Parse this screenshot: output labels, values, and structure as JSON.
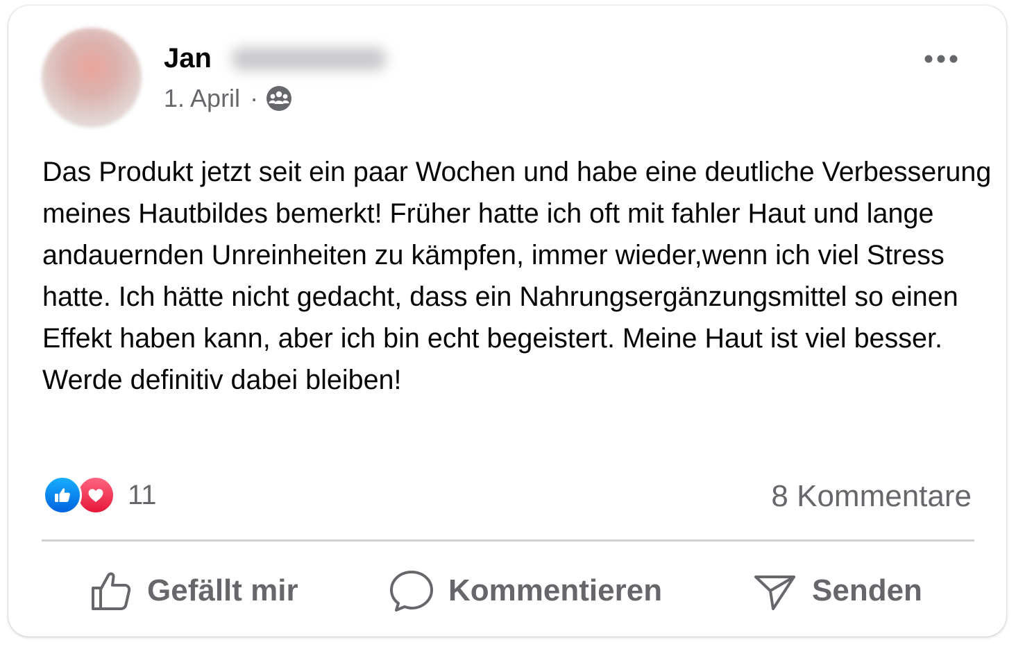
{
  "post": {
    "author_first_name": "Jan",
    "date": "1. April",
    "separator": "·",
    "audience_icon": "group-icon",
    "more_icon": "more-options-icon",
    "text": "Das Produkt jetzt seit ein paar Wochen und habe eine deutliche Verbesserung meines Hautbildes bemerkt! Früher hatte ich oft mit fahler Haut und lange andauernden Unreinheiten zu kämpfen, immer wieder,wenn ich viel Stress hatte. Ich hätte nicht gedacht, dass ein Nahrungsergänzungsmittel so einen Effekt haben kann, aber ich bin echt begeistert. Meine Haut ist viel besser. Werde definitiv dabei bleiben!"
  },
  "stats": {
    "reaction_count": "11",
    "reactions": [
      "like-icon",
      "love-icon"
    ],
    "comments": "8 Kommentare"
  },
  "actions": {
    "like_label": "Gefällt mir",
    "comment_label": "Kommentieren",
    "send_label": "Senden"
  },
  "colors": {
    "text_primary": "#050505",
    "text_secondary": "#65676b",
    "like_blue": "#1877f2",
    "love_red": "#f33e58",
    "divider": "#ced0d4"
  }
}
